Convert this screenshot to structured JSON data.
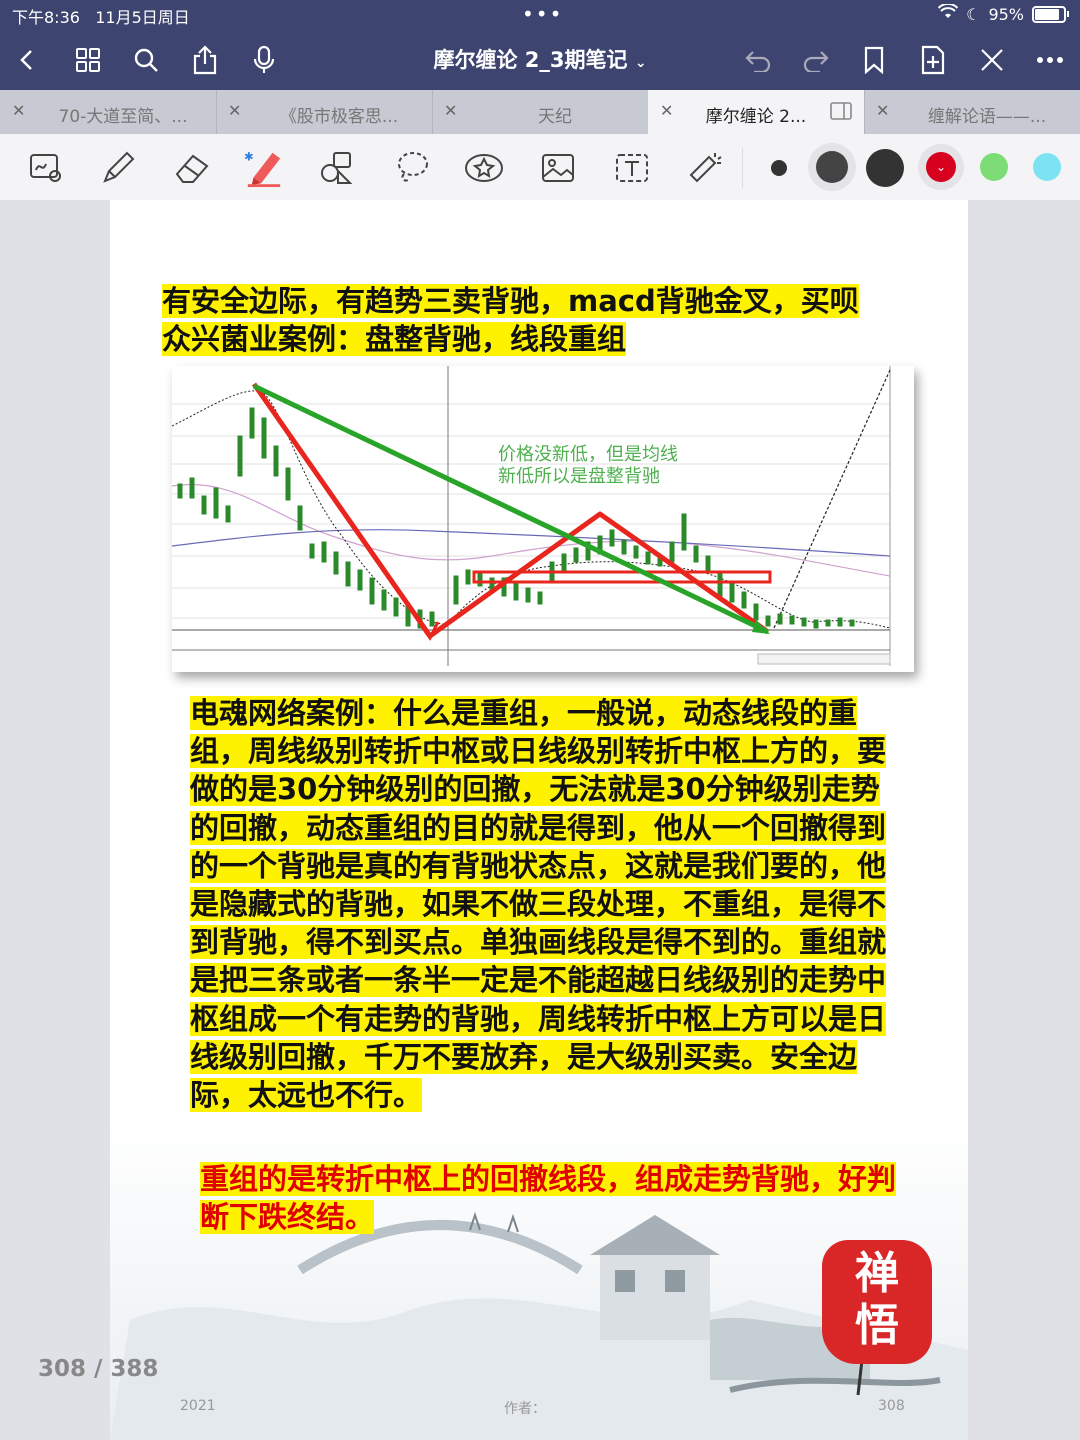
{
  "status": {
    "time": "下午8:36",
    "date": "11月5日周日",
    "battery": "95%",
    "battery_level": 0.95
  },
  "nav": {
    "title": "摩尔缠论 2_3期笔记"
  },
  "tabs": [
    {
      "label": "70-大道至简、..."
    },
    {
      "label": "《股市极客思..."
    },
    {
      "label": "天纪"
    },
    {
      "label": "摩尔缠论 2..."
    },
    {
      "label": "缠解论语——..."
    }
  ],
  "toolbar": {
    "colors": [
      "#333333",
      "#444444",
      "#333333",
      "#d8001f",
      "#7ddc75",
      "#7de3f3"
    ]
  },
  "page": {
    "heading_line1": "有安全边际，有趋势三卖背驰，macd背驰金叉，买呗",
    "heading_line2": "众兴菌业案例：盘整背驰，线段重组",
    "body": "电魂网络案例：什么是重组，一般说，动态线段的重组，周线级别转折中枢或日线级别转折中枢上方的，要做的是30分钟级别的回撤，无法就是30分钟级别走势的回撤，动态重组的目的就是得到，他从一个回撤得到的一个背驰是真的有背驰状态点，这就是我们要的，他是隐藏式的背驰，如果不做三段处理，不重组，是得不到背驰，得不到买点。单独画线段是得不到的。重组就是把三条或者一条半一定是不能超越日线级别的走势中枢组成一个有走势的背驰，周线转折中枢上方可以是日线级别回撤，千万不要放弃，是大级别买卖。安全边际，太远也不行。",
    "red_note": "重组的是转折中枢上的回撤线段，组成走势背驰，好判断下跌终结。",
    "seal": "禅悟",
    "footer_year": "2021",
    "footer_author": "作者：",
    "footer_page": "308"
  },
  "chart": {
    "annotation_line1": "价格没新低，但是均线",
    "annotation_line2": "新低所以是盘整背驰"
  },
  "page_indicator": "308 / 388"
}
